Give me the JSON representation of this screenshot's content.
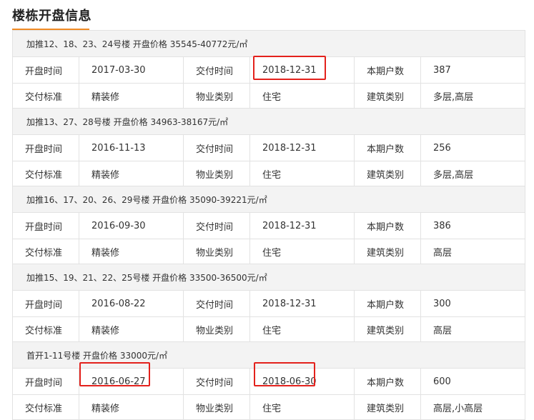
{
  "page": {
    "title": "楼栋开盘信息"
  },
  "labels": {
    "open_time": "开盘时间",
    "delivery_time": "交付时间",
    "households": "本期户数",
    "delivery_standard": "交付标准",
    "property_type": "物业类别",
    "building_type": "建筑类别"
  },
  "sections": [
    {
      "header": "加推12、18、23、24号楼 开盘价格 35545-40772元/㎡",
      "open_time": "2017-03-30",
      "delivery_time": "2018-12-31",
      "households": "387",
      "delivery_standard": "精装修",
      "property_type": "住宅",
      "building_type": "多层,高层"
    },
    {
      "header": "加推13、27、28号楼 开盘价格 34963-38167元/㎡",
      "open_time": "2016-11-13",
      "delivery_time": "2018-12-31",
      "households": "256",
      "delivery_standard": "精装修",
      "property_type": "住宅",
      "building_type": "多层,高层"
    },
    {
      "header": "加推16、17、20、26、29号楼 开盘价格 35090-39221元/㎡",
      "open_time": "2016-09-30",
      "delivery_time": "2018-12-31",
      "households": "386",
      "delivery_standard": "精装修",
      "property_type": "住宅",
      "building_type": "高层"
    },
    {
      "header": "加推15、19、21、22、25号楼 开盘价格 33500-36500元/㎡",
      "open_time": "2016-08-22",
      "delivery_time": "2018-12-31",
      "households": "300",
      "delivery_standard": "精装修",
      "property_type": "住宅",
      "building_type": "高层"
    },
    {
      "header": "首开1-11号楼 开盘价格 33000元/㎡",
      "open_time": "2016-06-27",
      "delivery_time": "2018-06-30",
      "households": "600",
      "delivery_standard": "精装修",
      "property_type": "住宅",
      "building_type": "高层,小高层"
    }
  ],
  "colors": {
    "accent": "#f08a24",
    "highlight": "#e3211c",
    "header_bg": "#f3f3f3",
    "border": "#e2e2e2"
  }
}
